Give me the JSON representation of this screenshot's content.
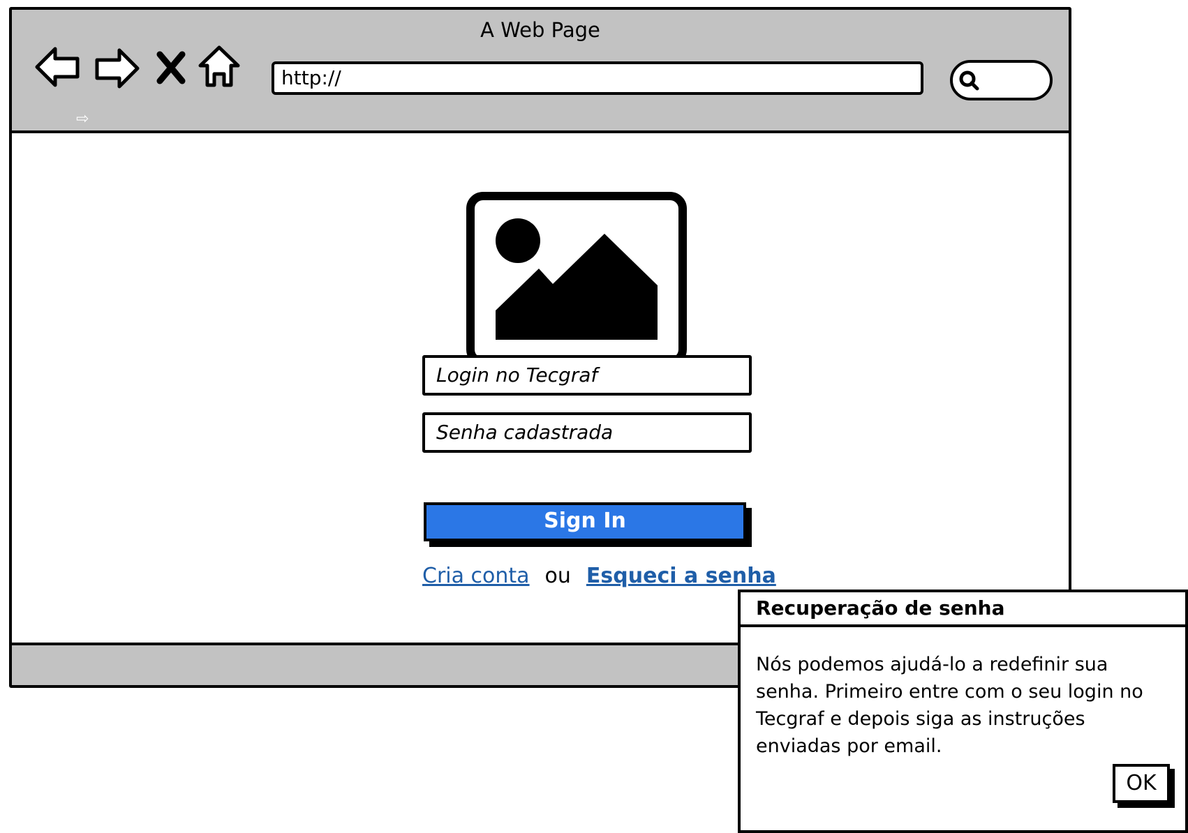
{
  "browser": {
    "title": "A Web Page",
    "url_placeholder": "http://",
    "nav_icons": [
      "back-arrow-icon",
      "forward-arrow-icon",
      "close-x-icon",
      "home-icon"
    ],
    "small_arrow": "⇨"
  },
  "login": {
    "username_placeholder": "Login no Tecgraf",
    "password_placeholder": "Senha cadastrada",
    "signin_label": "Sign In",
    "create_account_link": "Cria conta",
    "or_text": "ou",
    "forgot_password_link": "Esqueci a senha"
  },
  "dialog": {
    "title": "Recuperação de senha",
    "body": "Nós podemos ajudá-lo a redefinir sua senha. Primeiro entre com o seu login no Tecgraf e depois siga as instruções enviadas por email.",
    "ok_label": "OK"
  },
  "colors": {
    "chrome_gray": "#c2c2c2",
    "signin_blue": "#2b77e6",
    "link_blue": "#1f5ea8"
  }
}
